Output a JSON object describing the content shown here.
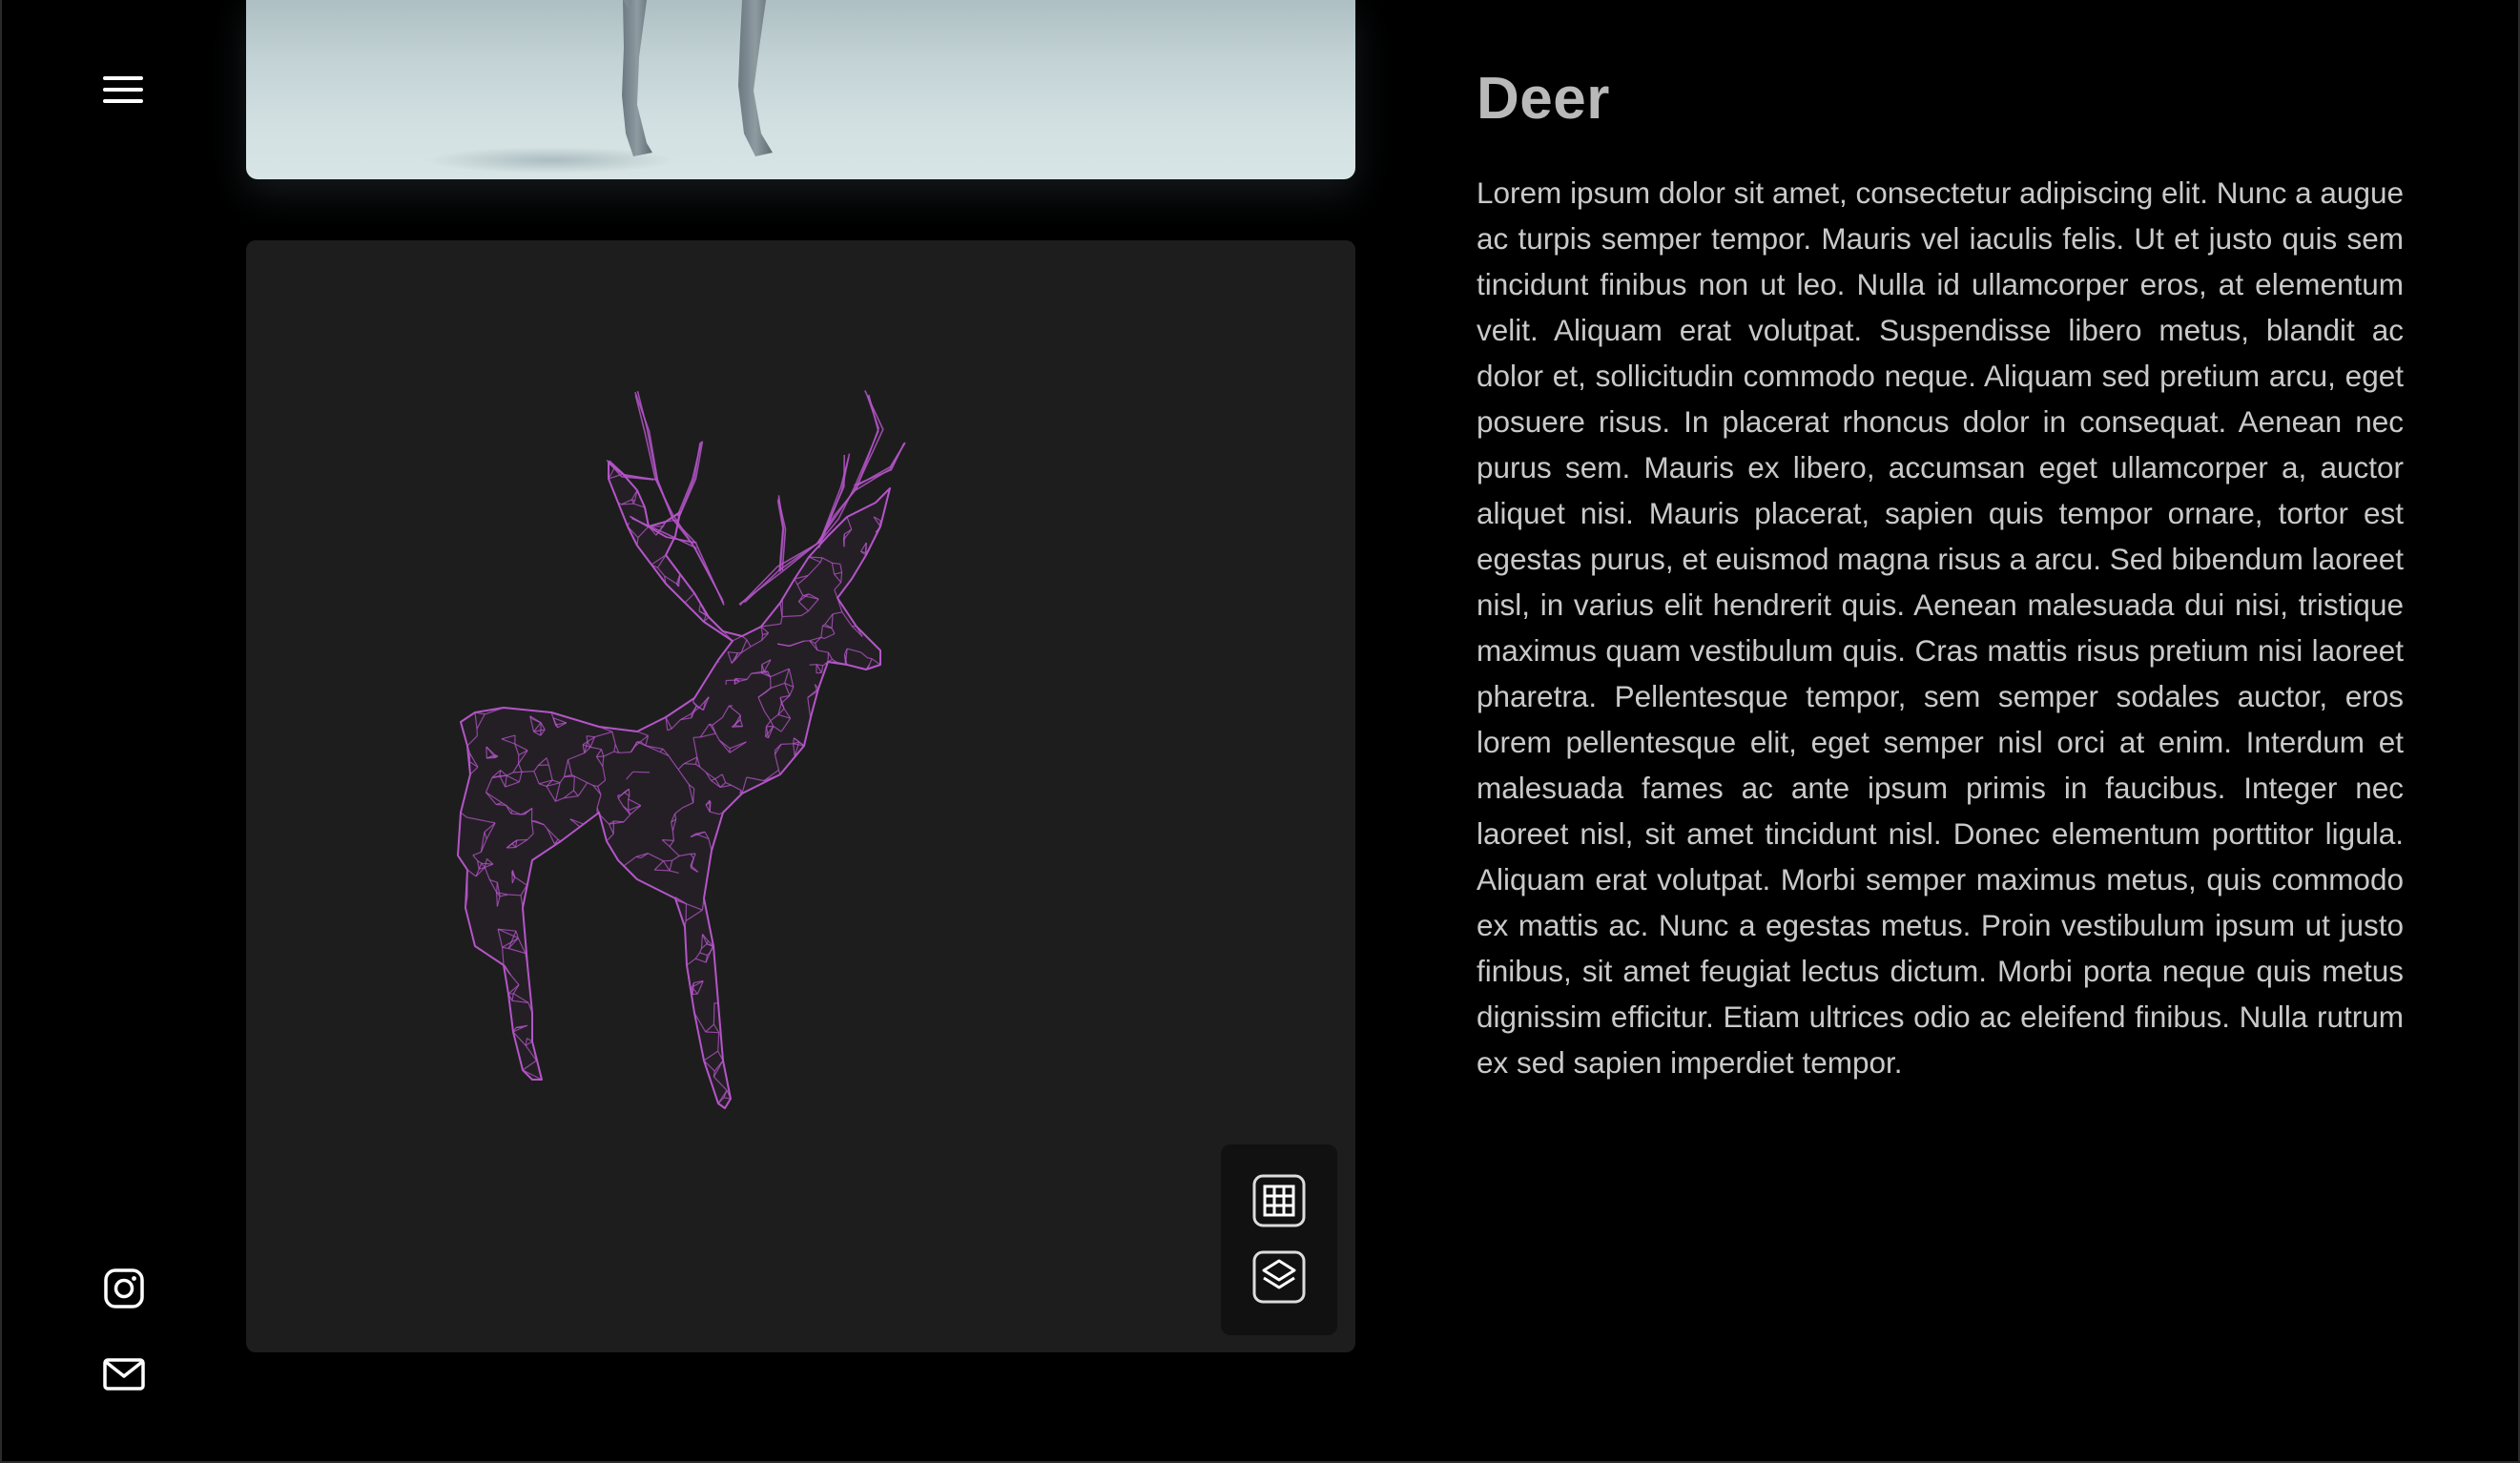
{
  "sidebar": {
    "menu_icon": "hamburger-menu-icon",
    "social": [
      {
        "icon": "instagram-icon"
      },
      {
        "icon": "mail-icon"
      }
    ]
  },
  "viewer": {
    "model_color": "#b455c8",
    "background_color": "#1d1d1d",
    "tools": [
      {
        "icon": "wireframe-grid-icon"
      },
      {
        "icon": "layers-icon"
      }
    ]
  },
  "article": {
    "title": "Deer",
    "body": "Lorem ipsum dolor sit amet, consectetur adipiscing elit. Nunc a augue ac turpis semper tempor. Mauris vel iaculis felis. Ut et justo quis sem tincidunt finibus non ut leo. Nulla id ullamcorper eros, at elementum velit. Aliquam erat volutpat. Suspendisse libero metus, blandit ac dolor et, sollicitudin commodo neque. Aliquam sed pretium arcu, eget posuere risus. In placerat rhoncus dolor in consequat. Aenean nec purus sem. Mauris ex libero, accumsan eget ullamcorper a, auctor aliquet nisi. Mauris placerat, sapien quis tempor ornare, tortor est egestas purus, et euismod magna risus a arcu. Sed bibendum laoreet nisl, in varius elit hendrerit quis. Aenean malesuada dui nisi, tristique maximus quam vestibulum quis. Cras mattis risus pretium nisi laoreet pharetra. Pellentesque tempor, sem semper sodales auctor, eros lorem pellentesque elit, eget semper nisl orci at enim. Interdum et malesuada fames ac ante ipsum primis in faucibus. Integer nec laoreet nisl, sit amet tincidunt nisl. Donec elementum porttitor ligula. Aliquam erat volutpat. Morbi semper maximus metus, quis commodo ex mattis ac. Nunc a egestas metus. Proin vestibulum ipsum ut justo finibus, sit amet feugiat lectus dictum. Morbi porta neque quis metus dignissim efficitur. Etiam ultrices odio ac eleifend finibus. Nulla rutrum ex sed sapien imperdiet tempor."
  }
}
